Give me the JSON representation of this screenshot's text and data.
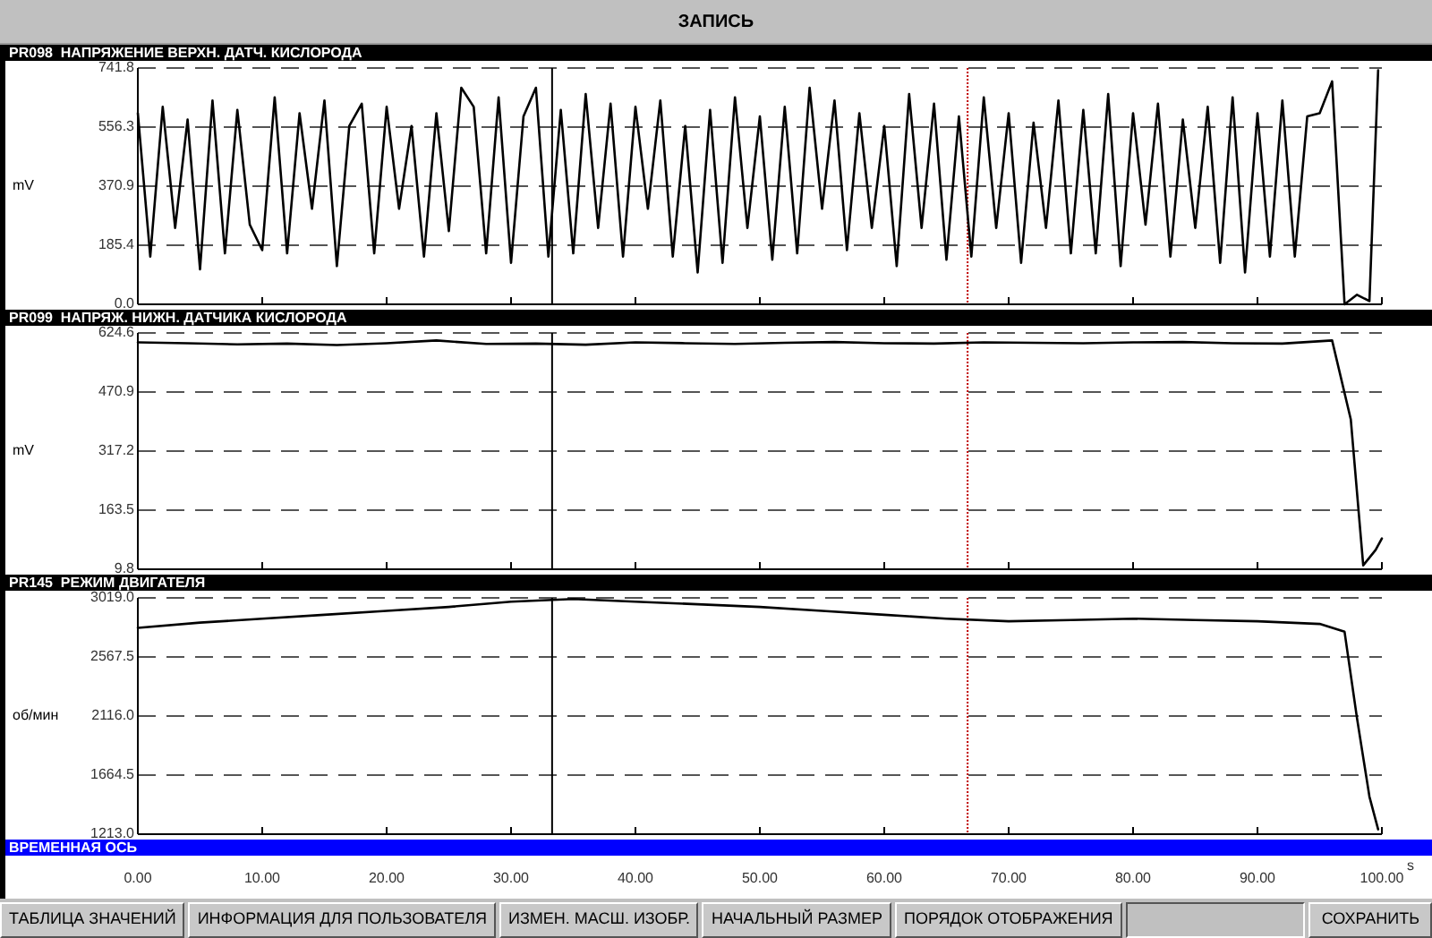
{
  "window": {
    "title": "ЗАПИСЬ"
  },
  "panels": [
    {
      "chart_data": {
        "type": "line",
        "title": "PR098  НАПРЯЖЕНИЕ ВЕРХН. ДАТЧ. КИСЛОРОДА",
        "grid": true,
        "ref_lines": [
          {
            "axis": "x",
            "value": 33.3,
            "color": "#000000"
          },
          {
            "axis": "x",
            "value": 66.7,
            "color": "#c00000"
          }
        ],
        "ylabel": "mV",
        "xlim": [
          0,
          100
        ],
        "ylim": [
          0,
          741.8
        ],
        "yticks": [
          {
            "value": 741.8,
            "label": "741.8"
          },
          {
            "value": 556.3,
            "label": "556.3"
          },
          {
            "value": 370.9,
            "label": "370.9"
          },
          {
            "value": 185.4,
            "label": "185.4"
          },
          {
            "value": 0,
            "label": "0.0"
          }
        ],
        "x": [
          0,
          1,
          2,
          3,
          4,
          5,
          6,
          7,
          8,
          9,
          10,
          11,
          12,
          13,
          14,
          15,
          16,
          17,
          18,
          19,
          20,
          21,
          22,
          23,
          24,
          25,
          26,
          27,
          28,
          29,
          30,
          31,
          32,
          33,
          34,
          35,
          36,
          37,
          38,
          39,
          40,
          41,
          42,
          43,
          44,
          45,
          46,
          47,
          48,
          49,
          50,
          51,
          52,
          53,
          54,
          55,
          56,
          57,
          58,
          59,
          60,
          61,
          62,
          63,
          64,
          65,
          66,
          67,
          68,
          69,
          70,
          71,
          72,
          73,
          74,
          75,
          76,
          77,
          78,
          79,
          80,
          81,
          82,
          83,
          84,
          85,
          86,
          87,
          88,
          89,
          90,
          91,
          92,
          93,
          94,
          95,
          96,
          97,
          98,
          99,
          99.7
        ],
        "series": [
          {
            "color": "#000000",
            "values": [
              600,
              150,
              620,
              240,
              580,
              110,
              640,
              160,
              610,
              250,
              170,
              650,
              160,
              600,
              300,
              640,
              120,
              560,
              630,
              160,
              620,
              300,
              560,
              150,
              600,
              230,
              680,
              620,
              160,
              650,
              130,
              590,
              680,
              150,
              610,
              160,
              660,
              240,
              630,
              150,
              620,
              300,
              640,
              150,
              560,
              100,
              610,
              130,
              650,
              240,
              590,
              140,
              620,
              160,
              680,
              300,
              640,
              170,
              600,
              240,
              560,
              120,
              660,
              240,
              630,
              140,
              590,
              150,
              650,
              240,
              600,
              130,
              570,
              240,
              640,
              160,
              610,
              160,
              660,
              120,
              600,
              250,
              630,
              150,
              580,
              240,
              620,
              130,
              650,
              100,
              600,
              150,
              640,
              150,
              590,
              600,
              700,
              0,
              30,
              10,
              735
            ]
          }
        ]
      }
    },
    {
      "chart_data": {
        "type": "line",
        "title": "PR099  НАПРЯЖ. НИЖН. ДАТЧИКА КИСЛОРОДА",
        "grid": true,
        "ref_lines": [
          {
            "axis": "x",
            "value": 33.3,
            "color": "#000000"
          },
          {
            "axis": "x",
            "value": 66.7,
            "color": "#c00000"
          }
        ],
        "ylabel": "mV",
        "xlim": [
          0,
          100
        ],
        "ylim": [
          9.8,
          624.6
        ],
        "yticks": [
          {
            "value": 624.6,
            "label": "624.6"
          },
          {
            "value": 470.9,
            "label": "470.9"
          },
          {
            "value": 317.2,
            "label": "317.2"
          },
          {
            "value": 163.5,
            "label": "163.5"
          },
          {
            "value": 9.8,
            "label": "9.8"
          }
        ],
        "x": [
          0,
          4,
          8,
          12,
          16,
          20,
          24,
          28,
          32,
          36,
          40,
          44,
          48,
          52,
          56,
          60,
          64,
          68,
          72,
          76,
          80,
          84,
          88,
          92,
          96,
          97.5,
          98.5,
          99.5,
          100
        ],
        "series": [
          {
            "color": "#000000",
            "values": [
              600,
              598,
              595,
              597,
              593,
              598,
              605,
              596,
              597,
              594,
              600,
              598,
              596,
              599,
              601,
              598,
              597,
              600,
              599,
              598,
              600,
              601,
              598,
              597,
              605,
              400,
              20,
              60,
              90
            ]
          }
        ]
      }
    },
    {
      "chart_data": {
        "type": "line",
        "title": "PR145  РЕЖИМ ДВИГАТЕЛЯ",
        "grid": true,
        "ref_lines": [
          {
            "axis": "x",
            "value": 33.3,
            "color": "#000000"
          },
          {
            "axis": "x",
            "value": 66.7,
            "color": "#c00000"
          }
        ],
        "ylabel": "об/мин",
        "xlabel": "s",
        "xlim": [
          0,
          100
        ],
        "xticks": [
          {
            "value": 0,
            "label": "0.00"
          },
          {
            "value": 10,
            "label": "10.00"
          },
          {
            "value": 20,
            "label": "20.00"
          },
          {
            "value": 30,
            "label": "30.00"
          },
          {
            "value": 40,
            "label": "40.00"
          },
          {
            "value": 50,
            "label": "50.00"
          },
          {
            "value": 60,
            "label": "60.00"
          },
          {
            "value": 70,
            "label": "70.00"
          },
          {
            "value": 80,
            "label": "80.00"
          },
          {
            "value": 90,
            "label": "90.00"
          },
          {
            "value": 100,
            "label": "100.00"
          }
        ],
        "ylim": [
          1213,
          3019
        ],
        "yticks": [
          {
            "value": 3019,
            "label": "3019.0"
          },
          {
            "value": 2567.5,
            "label": "2567.5"
          },
          {
            "value": 2116,
            "label": "2116.0"
          },
          {
            "value": 1664.5,
            "label": "1664.5"
          },
          {
            "value": 1213,
            "label": "1213.0"
          }
        ],
        "x": [
          0,
          5,
          10,
          15,
          20,
          25,
          30,
          35,
          40,
          45,
          50,
          55,
          60,
          65,
          70,
          75,
          80,
          85,
          90,
          95,
          97,
          98,
          99,
          99.7
        ],
        "series": [
          {
            "color": "#000000",
            "values": [
              2790,
              2830,
              2860,
              2890,
              2920,
              2950,
              2990,
              3010,
              2990,
              2970,
              2950,
              2920,
              2890,
              2860,
              2840,
              2850,
              2860,
              2850,
              2840,
              2820,
              2760,
              2100,
              1500,
              1250
            ]
          }
        ]
      }
    }
  ],
  "time_axis": {
    "title": "ВРЕМЕННАЯ ОСЬ"
  },
  "buttons_left": [
    "ТАБЛИЦА ЗНАЧЕНИЙ",
    "ИНФОРМАЦИЯ ДЛЯ ПОЛЬЗОВАТЕЛЯ",
    "ИЗМЕН. МАСШ. ИЗОБР.",
    "НАЧАЛЬНЫЙ РАЗМЕР",
    "ПОРЯДОК ОТОБРАЖЕНИЯ"
  ],
  "buttons_right": [
    "СОХРАНИТЬ"
  ]
}
